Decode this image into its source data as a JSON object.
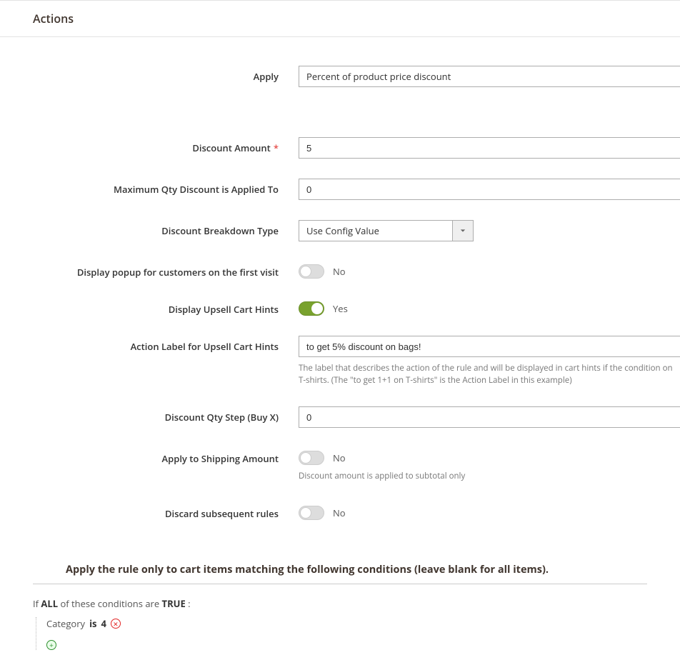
{
  "section_title": "Actions",
  "fields": {
    "apply": {
      "label": "Apply",
      "value": "Percent of product price discount"
    },
    "discount_amount": {
      "label": "Discount Amount",
      "required_mark": "*",
      "value": "5"
    },
    "max_qty": {
      "label": "Maximum Qty Discount is Applied To",
      "value": "0"
    },
    "breakdown": {
      "label": "Discount Breakdown Type",
      "value": "Use Config Value"
    },
    "popup_first": {
      "label": "Display popup for customers on the first visit",
      "state": "off",
      "text": "No"
    },
    "upsell_hints": {
      "label": "Display Upsell Cart Hints",
      "state": "on",
      "text": "Yes"
    },
    "action_label": {
      "label": "Action Label for Upsell Cart Hints",
      "value": "to get 5% discount on bags!",
      "help": "The label that describes the action of the rule and will be displayed in cart hints if the condition on T-shirts. (The \"to get 1+1 on T-shirts\" is the Action Label in this example)"
    },
    "qty_step": {
      "label": "Discount Qty Step (Buy X)",
      "value": "0"
    },
    "apply_shipping": {
      "label": "Apply to Shipping Amount",
      "state": "off",
      "text": "No",
      "help": "Discount amount is applied to subtotal only"
    },
    "discard": {
      "label": "Discard subsequent rules",
      "state": "off",
      "text": "No"
    }
  },
  "conditions": {
    "heading": "Apply the rule only to cart items matching the following conditions (leave blank for all items).",
    "prefix_if": "If ",
    "aggregator": "ALL",
    "middle": "  of these conditions are ",
    "truth": "TRUE",
    "suffix": " :",
    "rule": {
      "attribute": "Category",
      "operator": "is",
      "value": "4"
    }
  }
}
